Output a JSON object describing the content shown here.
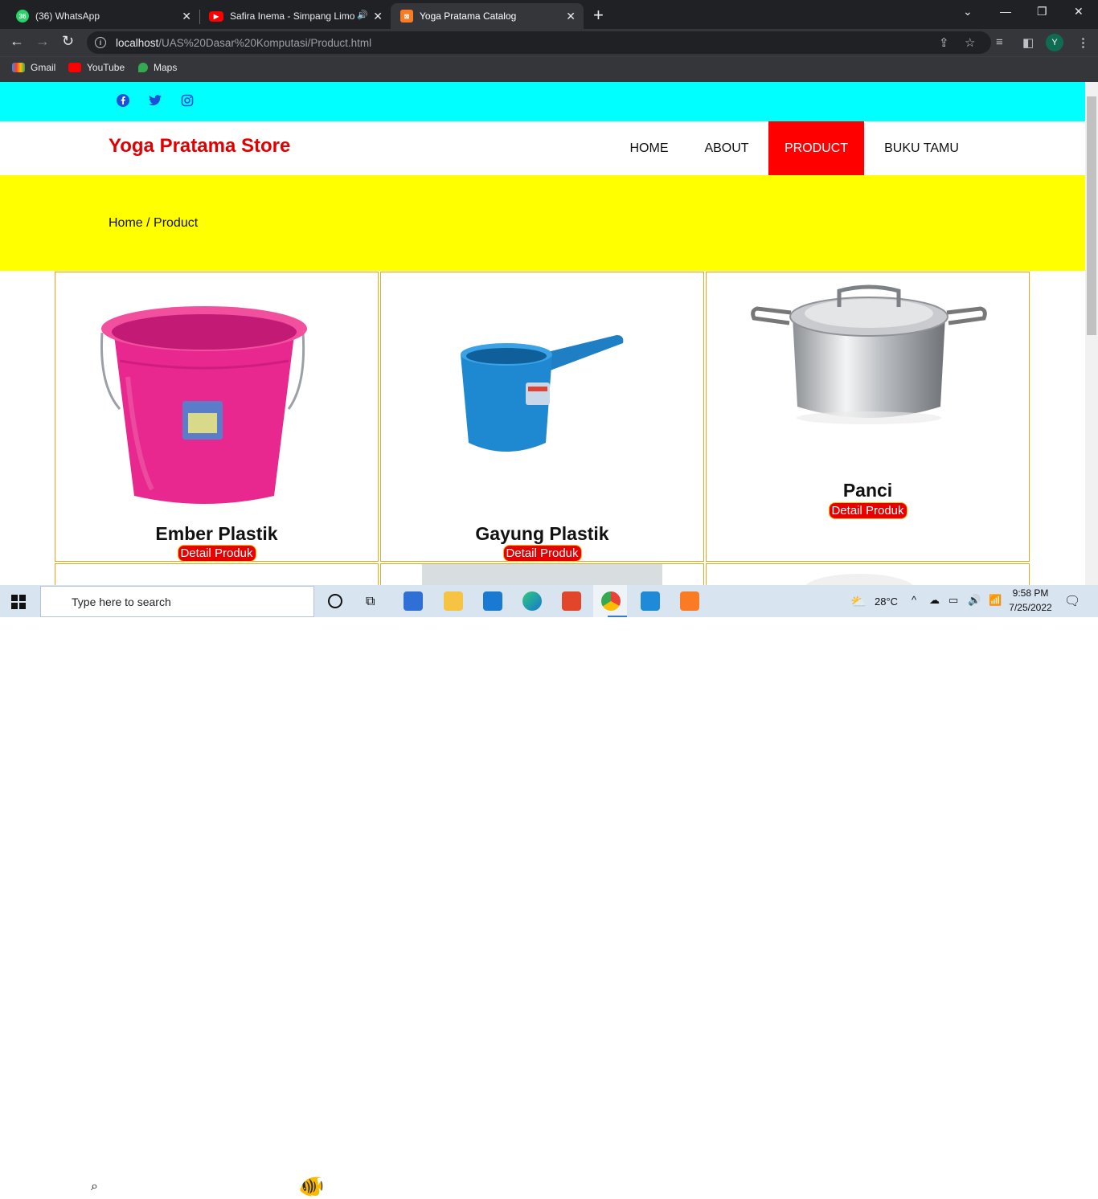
{
  "browser": {
    "tabs": [
      {
        "title": "(36) WhatsApp",
        "badge": "36",
        "active": false
      },
      {
        "title": "Safira Inema - Simpang Limo",
        "active": false,
        "audio": true
      },
      {
        "title": "Yoga Pratama Catalog",
        "active": true
      }
    ],
    "url_host": "localhost",
    "url_path": "/UAS%20Dasar%20Komputasi/Product.html",
    "profile_initial": "Y",
    "bookmarks": [
      "Gmail",
      "YouTube",
      "Maps"
    ]
  },
  "site": {
    "social": [
      "facebook-icon",
      "twitter-icon",
      "instagram-icon"
    ],
    "brand": "Yoga Pratama Store",
    "nav": [
      "HOME",
      "ABOUT",
      "PRODUCT",
      "BUKU TAMU"
    ],
    "active_nav": "PRODUCT",
    "breadcrumb": "Home / Product",
    "products": [
      {
        "name": "Ember Plastik",
        "button": "Detail Produk"
      },
      {
        "name": "Gayung Plastik",
        "button": "Detail Produk"
      },
      {
        "name": "Panci",
        "button": "Detail Produk"
      }
    ],
    "colors": {
      "topbar": "#00ffff",
      "brand": "#e00000",
      "hero": "#ffff00",
      "active_nav": "#ff0000",
      "card_border": "#e0a920"
    }
  },
  "taskbar": {
    "search_placeholder": "Type here to search",
    "weather": "28°C",
    "time": "9:58 PM",
    "date": "7/25/2022"
  }
}
